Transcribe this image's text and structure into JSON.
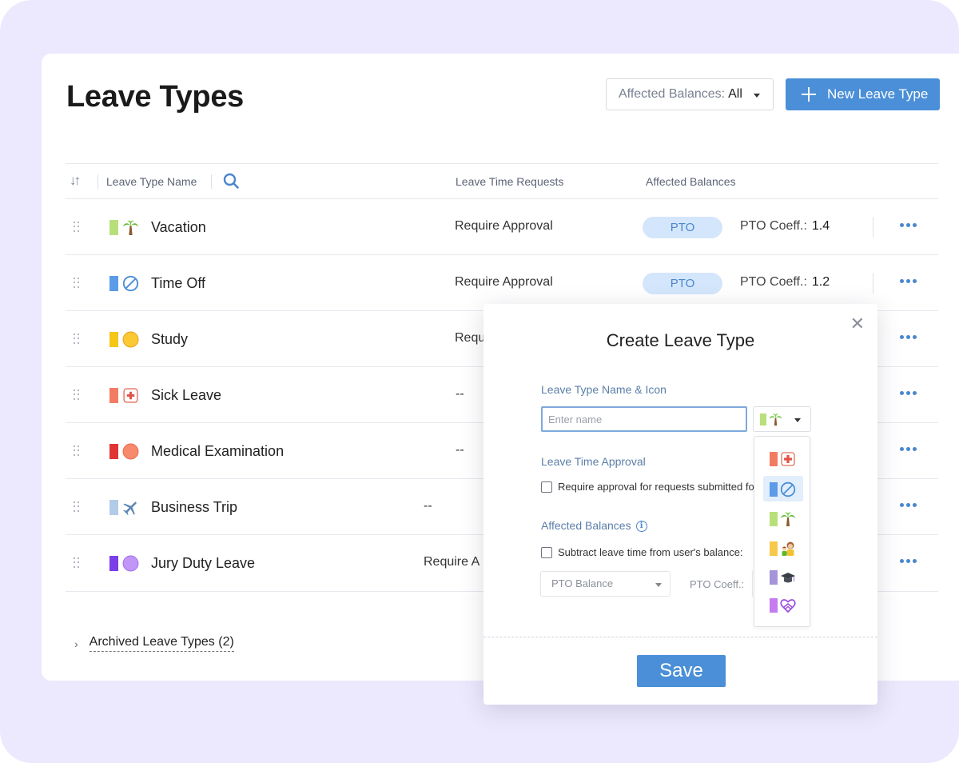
{
  "page": {
    "title": "Leave Types",
    "filter": {
      "label": "Affected Balances:",
      "value": "All"
    },
    "new_button_label": "New Leave Type"
  },
  "table": {
    "columns": {
      "name": "Leave Type Name",
      "requests": "Leave Time Requests",
      "balances": "Affected Balances"
    },
    "rows": [
      {
        "name": "Vacation",
        "icon": "palm-tree-icon",
        "color": "#b8e07a",
        "requests": "Require Approval",
        "balance": "PTO",
        "coeff_label": "PTO Coeff.:",
        "coeff": "1.4"
      },
      {
        "name": "Time Off",
        "icon": "prohibited-icon",
        "color": "#5b9be8",
        "requests": "Require Approval",
        "balance": "PTO",
        "coeff_label": "PTO Coeff.:",
        "coeff": "1.2"
      },
      {
        "name": "Study",
        "icon": "yellow-circle-icon",
        "color": "#f6c617",
        "requests": "Requ"
      },
      {
        "name": "Sick Leave",
        "icon": "medical-cross-icon",
        "color": "#f27c63",
        "requests": "--"
      },
      {
        "name": "Medical Examination",
        "icon": "red-circle-icon",
        "color": "#e03535",
        "requests": "--"
      },
      {
        "name": "Business Trip",
        "icon": "airplane-icon",
        "color": "#b1cbe8",
        "requests": "--"
      },
      {
        "name": "Jury Duty Leave",
        "icon": "purple-circle-icon",
        "color": "#7b3ee8",
        "requests": "Require A"
      }
    ],
    "archived_label": "Archived Leave Types (2)"
  },
  "modal": {
    "title": "Create Leave Type",
    "name_section_label": "Leave Type Name & Icon",
    "name_placeholder": "Enter name",
    "name_value": "",
    "selected_icon": {
      "icon": "palm-tree-icon",
      "color": "#b8e07a"
    },
    "icon_options": [
      {
        "icon": "medical-cross-icon",
        "color": "#f27c63"
      },
      {
        "icon": "prohibited-icon",
        "color": "#5b9be8",
        "selected": true
      },
      {
        "icon": "palm-tree-icon",
        "color": "#b8e07a"
      },
      {
        "icon": "parent-child-icon",
        "color": "#f6c94a"
      },
      {
        "icon": "graduation-cap-icon",
        "color": "#a794d8"
      },
      {
        "icon": "heart-hands-icon",
        "color": "#c47cf0"
      }
    ],
    "approval_section_label": "Leave Time Approval",
    "approval_checkbox_label": "Require approval for requests submitted fo",
    "balances_section_label": "Affected Balances",
    "balances_checkbox_label": "Subtract leave time from user's balance:",
    "balance_select_value": "PTO Balance",
    "coeff_label": "PTO Coeff.:",
    "save_label": "Save"
  },
  "colors": {
    "accent": "#4a8fd7",
    "badge_bg": "#d4e6fb",
    "background": "#ece8fd"
  }
}
